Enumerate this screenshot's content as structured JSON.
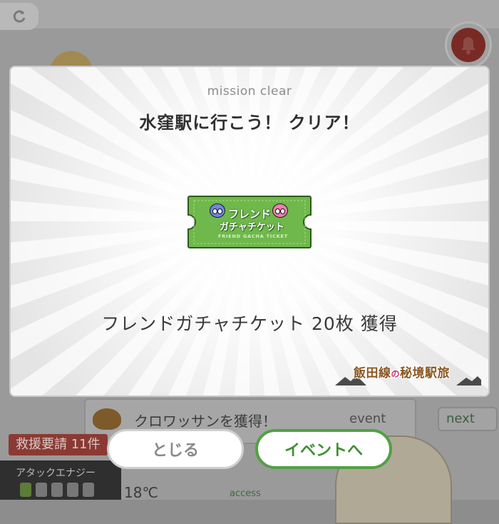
{
  "background": {
    "news_text": "クロワッサンを獲得！",
    "news_tag": "event",
    "next_label": "next",
    "rescue_label": "救援要請 11件",
    "attack_label": "アタックエナジー",
    "energy_total": 5,
    "energy_filled": 1,
    "temperature": "18℃",
    "access_label": "access"
  },
  "modal": {
    "subtitle": "mission clear",
    "title": "水窪駅に行こう！ クリア！",
    "ticket": {
      "line1": "フレンド",
      "line2": "ガチャチケット",
      "sub": "FRIEND GACHA TICKET"
    },
    "reward_text": "フレンドガチャチケット 20枚 獲得",
    "logo": {
      "main": "飯田線",
      "connector": "の",
      "tail": "秘境駅旅"
    }
  },
  "buttons": {
    "close_label": "とじる",
    "event_label": "イベントへ"
  },
  "colors": {
    "accent_green": "#52a044",
    "ticket_green": "#6fb84b",
    "rescue_red": "#8b3a33"
  }
}
